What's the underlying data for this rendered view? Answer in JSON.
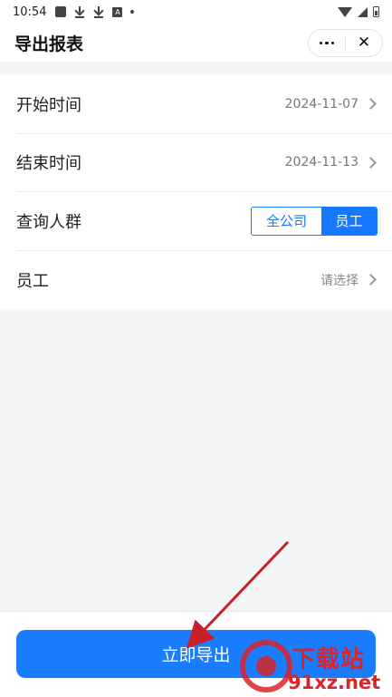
{
  "status_bar": {
    "time": "10:54",
    "left_icons": [
      "app-square-icon",
      "download-icon",
      "download-icon",
      "a-app-icon",
      "dot-icon"
    ],
    "right_icons": [
      "wifi-icon",
      "signal-icon",
      "battery-icon"
    ]
  },
  "header": {
    "title": "导出报表",
    "more_icon": "more-dots-icon",
    "close_icon": "close-icon",
    "close_glyph": "✕"
  },
  "form": {
    "start_time": {
      "label": "开始时间",
      "value": "2024-11-07"
    },
    "end_time": {
      "label": "结束时间",
      "value": "2024-11-13"
    },
    "query_group": {
      "label": "查询人群",
      "options": [
        "全公司",
        "员工"
      ],
      "selected": "员工"
    },
    "employee": {
      "label": "员工",
      "placeholder": "请选择"
    }
  },
  "footer": {
    "export_label": "立即导出"
  },
  "watermark": {
    "top_text": "下载站",
    "bottom_text": "91xz.net"
  },
  "colors": {
    "accent": "#1677ff",
    "button": "#1a7cff",
    "annotation_arrow": "#c8202a",
    "watermark": "#d9242a"
  }
}
